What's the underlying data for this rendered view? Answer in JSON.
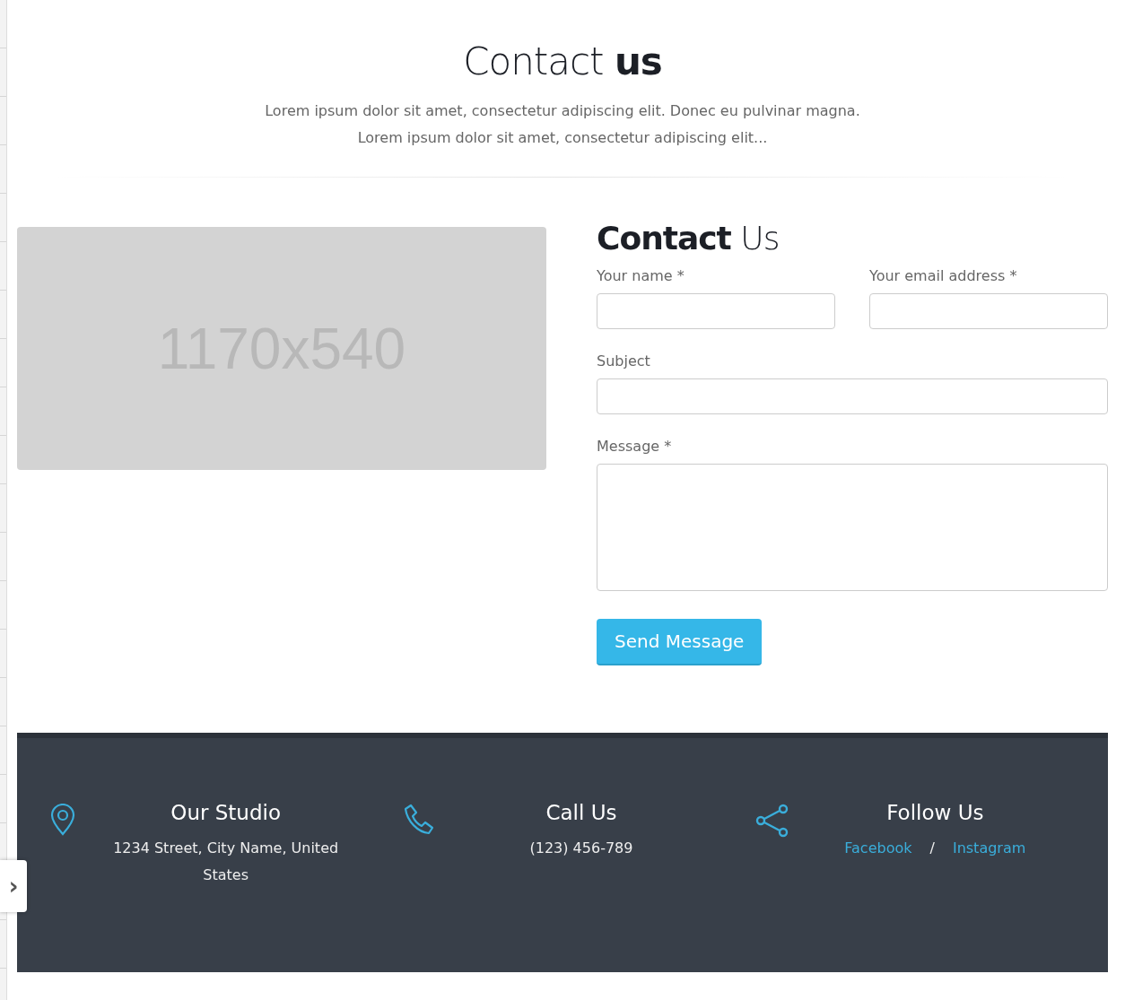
{
  "header": {
    "title": "Contact **us**",
    "lines": [
      "Lorem ipsum dolor sit amet, consectetur adipiscing elit. Donec eu pulvinar magna.",
      "Lorem ipsum dolor sit amet, consectetur adipiscing elit..."
    ]
  },
  "image_placeholder": {
    "label": "1170x540"
  },
  "form": {
    "title": "**Contact** Us",
    "fields": [
      {
        "label": "Your name *",
        "kind": "short"
      },
      {
        "label": "Your email address *",
        "kind": "short"
      },
      {
        "label": "Subject",
        "kind": "wide"
      },
      {
        "label": "Message *",
        "kind": "textarea"
      }
    ],
    "submit": "Send Message"
  },
  "footer": {
    "columns": [
      {
        "title": "Our Studio",
        "text": "1234 Street, City Name, United States"
      },
      {
        "title": "Call Us",
        "text": "(123) 456-789"
      },
      {
        "title": "Follow Us",
        "links": [
          "Facebook",
          "Instagram"
        ],
        "separator": "/"
      }
    ]
  },
  "side_toggle": {
    "symbol": "›"
  }
}
